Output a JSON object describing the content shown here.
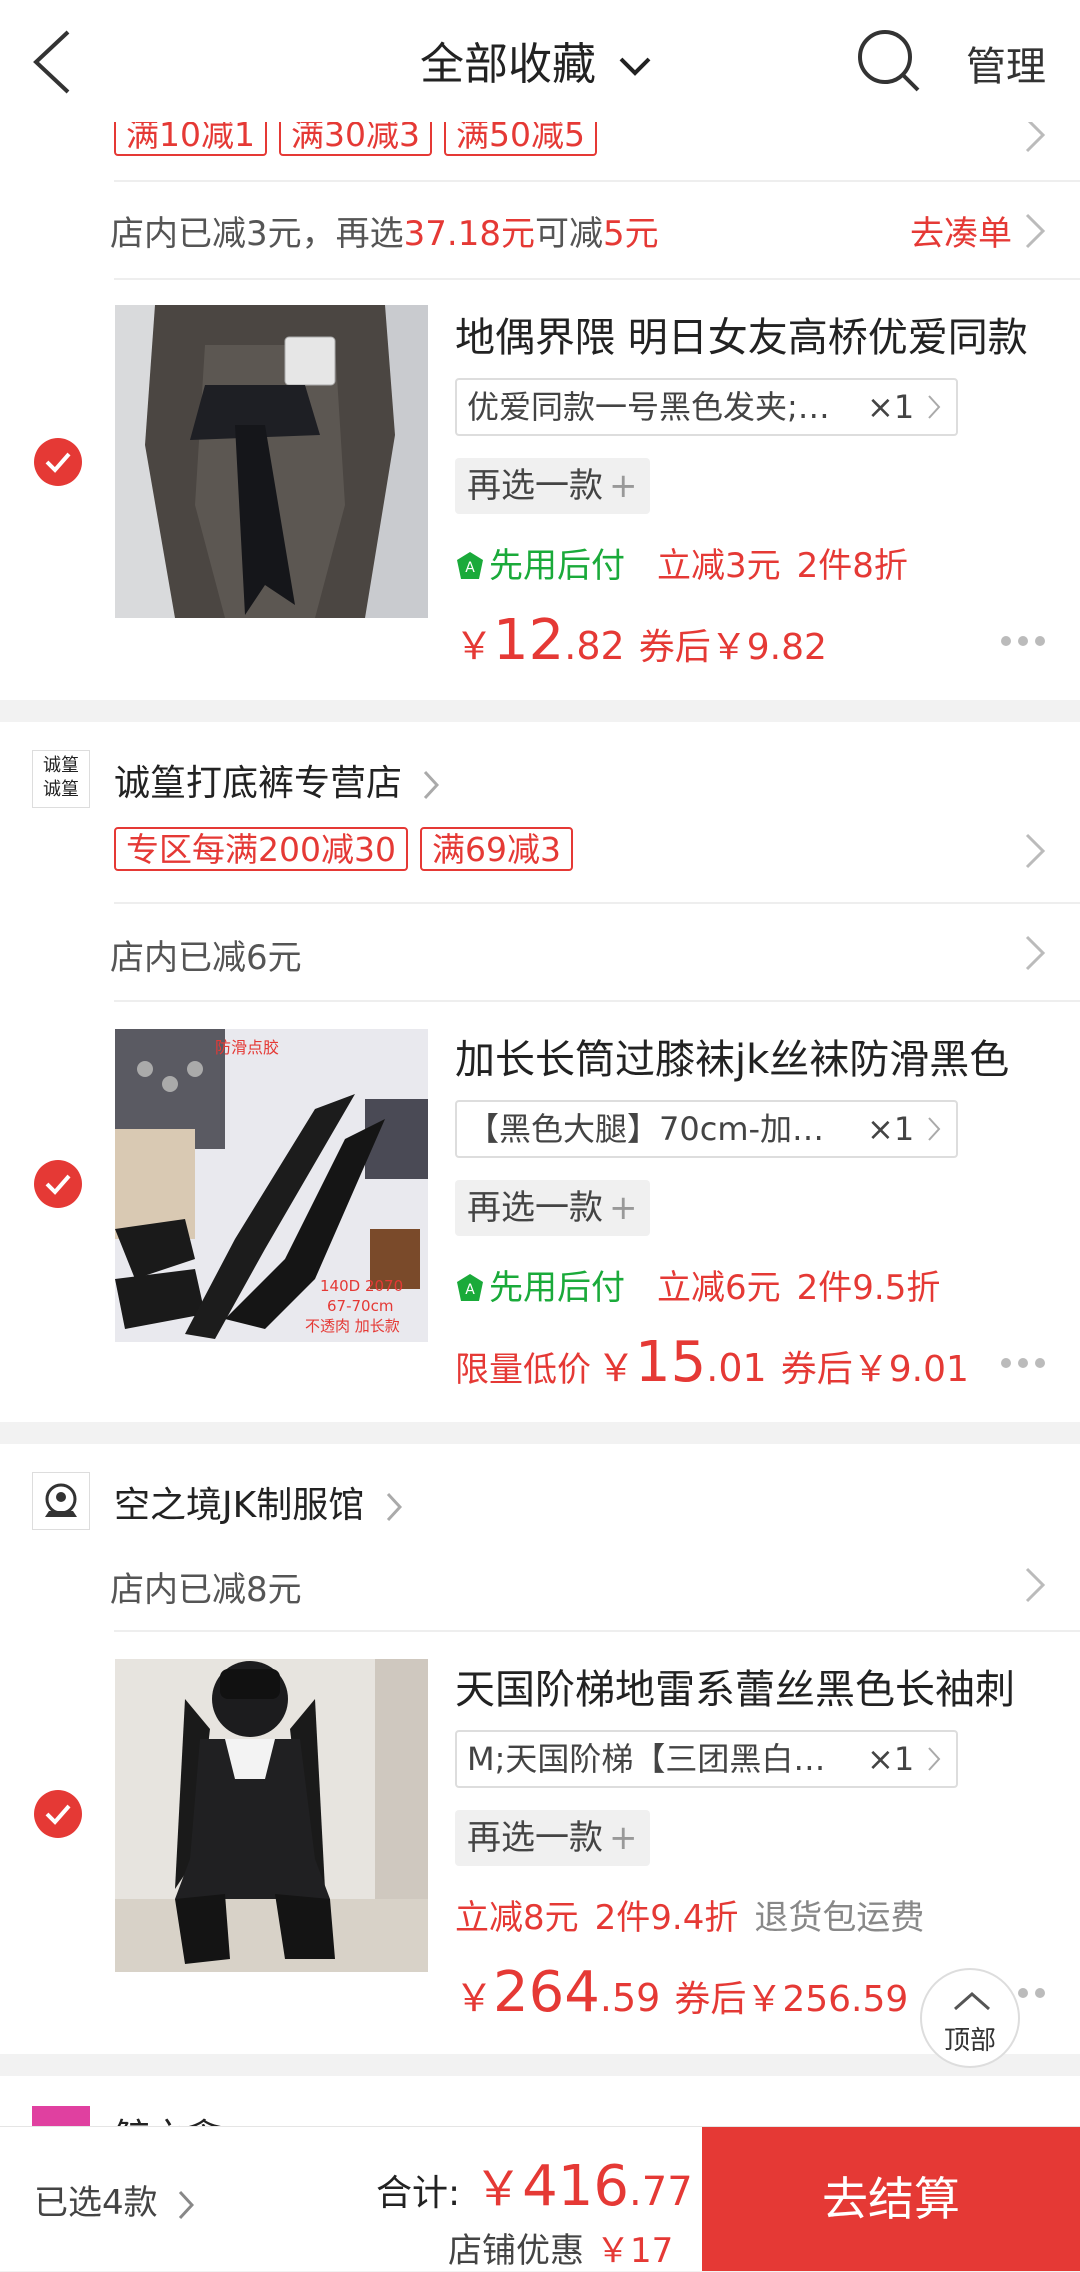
{
  "header": {
    "back_icon": "chevron-left-icon",
    "title": "全部收藏",
    "title_icon": "chevron-down-icon",
    "search_icon": "search-icon",
    "manage": "管理"
  },
  "shop0": {
    "promos": [
      "满10减1",
      "满30减3",
      "满50减5"
    ],
    "saved_prefix": "店内已减3元，再选",
    "saved_amount": "37.18元",
    "saved_mid": "可减",
    "saved_value": "5元",
    "go_link": "去凑单",
    "item": {
      "name": "地偶界隈 明日女友高桥优爱同款",
      "sku": "优爱同款一号黑色发夹;…",
      "qty": "×1",
      "reselect": "再选一款",
      "reselect_icon": "+",
      "benefit_pay": "先用后付",
      "benefit_cut": "立减3元",
      "benefit_discount": "2件8折",
      "price_symbol": "￥",
      "price_int": "12",
      "price_dec": ".82",
      "after_coupon": "券后￥9.82"
    }
  },
  "shop1": {
    "name": "诚篁打底裤专营店",
    "logo_text": "诚篁诚篁",
    "promos": [
      "专区每满200减30",
      "满69减3"
    ],
    "saved": "店内已减6元",
    "item": {
      "name": "加长长筒过膝袜jk丝袜防滑黑色",
      "sku": "【黑色大腿】70cm-加…",
      "qty": "×1",
      "reselect": "再选一款",
      "reselect_icon": "+",
      "benefit_pay": "先用后付",
      "benefit_cut": "立减6元",
      "benefit_discount": "2件9.5折",
      "price_label": "限量低价",
      "price_symbol": "￥",
      "price_int": "15",
      "price_dec": ".01",
      "after_coupon": "券后￥9.01",
      "thumb_text_top": "防滑点胶",
      "thumb_text_bottom": "140D 2070\n67-70cm\n不透肉 加长款"
    }
  },
  "shop2": {
    "name": "空之境JK制服馆",
    "saved": "店内已减8元",
    "item": {
      "name": "天国阶梯地雷系蕾丝黑色长袖刺",
      "sku": "M;天国阶梯【三团黑白…",
      "qty": "×1",
      "reselect": "再选一款",
      "reselect_icon": "+",
      "benefit_cut": "立减8元",
      "benefit_discount": "2件9.4折",
      "benefit_return": "退货包运费",
      "price_symbol": "￥",
      "price_int": "264",
      "price_dec": ".59",
      "after_coupon": "券后￥256.59"
    }
  },
  "shop3": {
    "name": "鲸之禽"
  },
  "to_top": "顶部",
  "footer": {
    "selected": "已选4款",
    "total_label": "合计:",
    "total_symbol": "￥",
    "total_int": "416",
    "total_dec": ".77",
    "discount_label": "店铺优惠",
    "discount_value": "￥17",
    "checkout": "去结算"
  },
  "colors": {
    "accent": "#e53935",
    "green": "#1aaa3a"
  }
}
